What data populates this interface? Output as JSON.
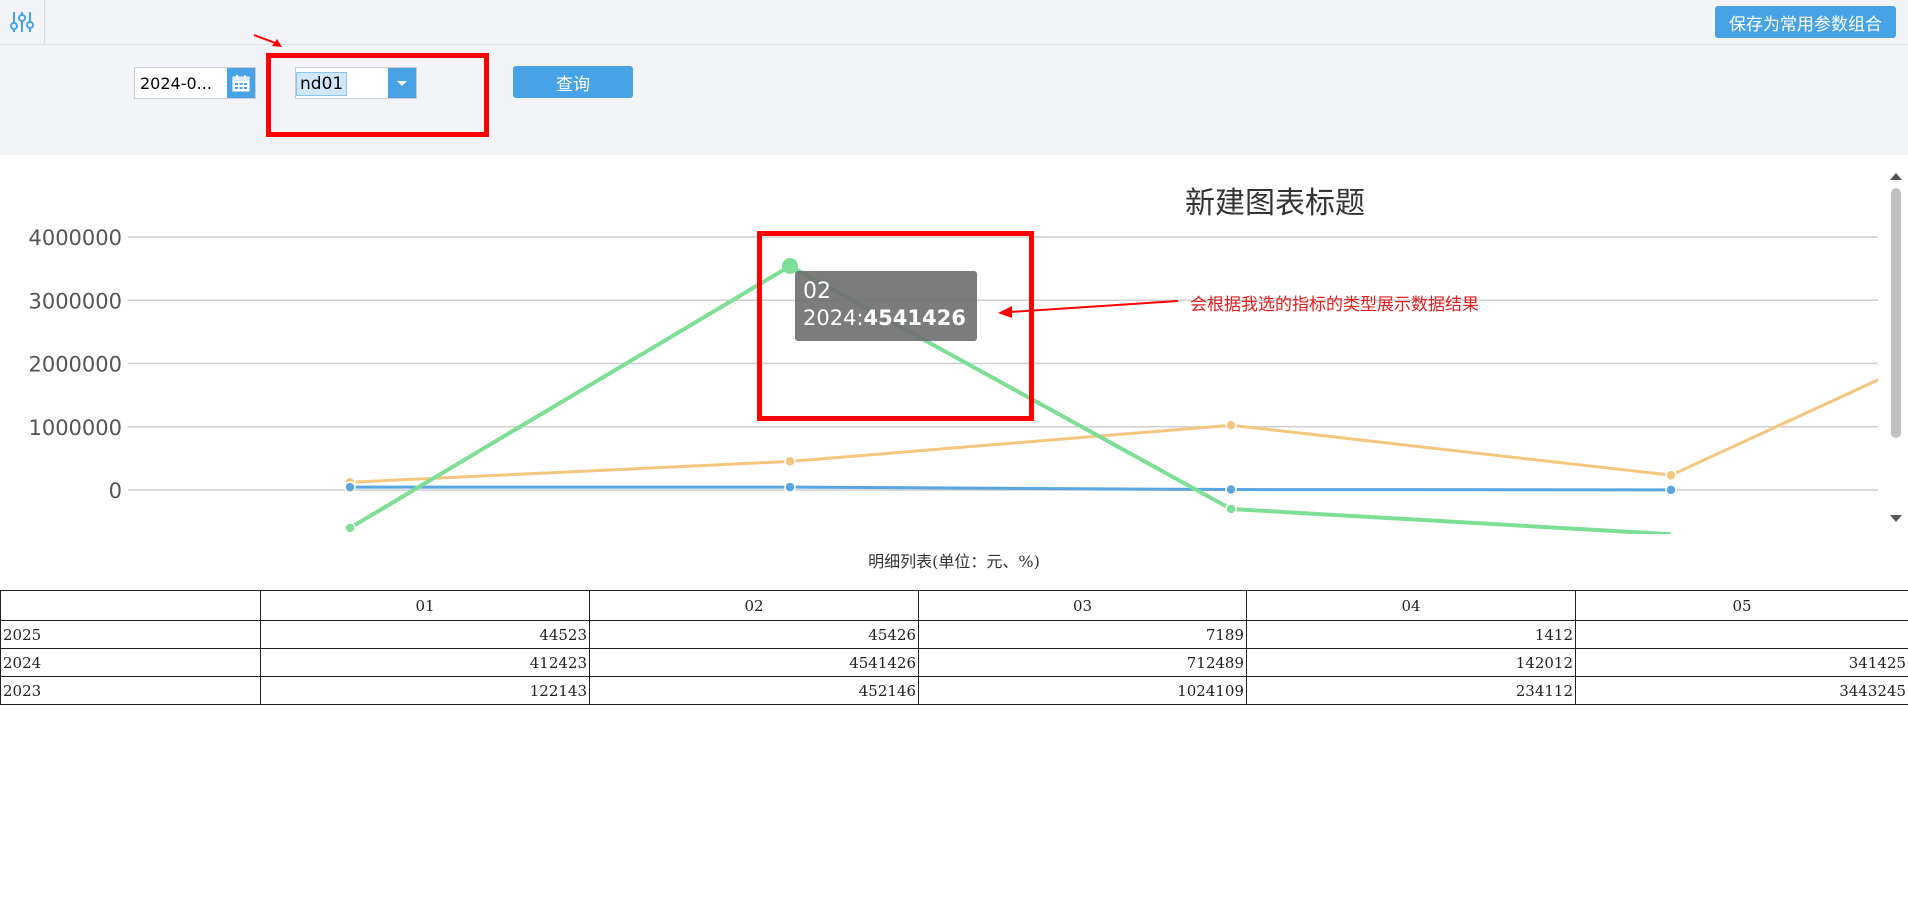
{
  "toolbar": {
    "save_label": "保存为常用参数组合",
    "menu_icon": "sliders-icon"
  },
  "params": {
    "date_value": "2024-0...",
    "indicator_value": "nd01",
    "query_label": "查询"
  },
  "chart_data": {
    "type": "line",
    "title": "新建图表标题",
    "categories": [
      "01",
      "02",
      "03",
      "04",
      "05"
    ],
    "series": [
      {
        "name": "2025",
        "color": "#5aa6e0",
        "values": [
          44523,
          45426,
          7189,
          1412,
          null
        ]
      },
      {
        "name": "2024",
        "color": "#7ddf95",
        "values": [
          -600000,
          3541426,
          -300000,
          -700000,
          null
        ]
      },
      {
        "name": "2023",
        "color": "#f5c77e",
        "values": [
          122143,
          452146,
          1024109,
          234112,
          3443245
        ]
      }
    ],
    "y_ticks": [
      "4000000",
      "3000000",
      "2000000",
      "1000000",
      "0"
    ],
    "ylim": [
      -800000,
      4000000
    ],
    "grid": true,
    "tooltip": {
      "category": "02",
      "series": "2024",
      "value": "4541426"
    }
  },
  "annotation": {
    "text": "会根据我选的指标的类型展示数据结果"
  },
  "table": {
    "caption": "明细列表(单位：元、%)",
    "headers": [
      "",
      "01",
      "02",
      "03",
      "04",
      "05"
    ],
    "rows": [
      [
        "2025",
        "44523",
        "45426",
        "7189",
        "1412",
        ""
      ],
      [
        "2024",
        "412423",
        "4541426",
        "712489",
        "142012",
        "341425"
      ],
      [
        "2023",
        "122143",
        "452146",
        "1024109",
        "234112",
        "3443245"
      ]
    ]
  },
  "colors": {
    "accent": "#47a3e6",
    "highlight": "#ff0000"
  }
}
